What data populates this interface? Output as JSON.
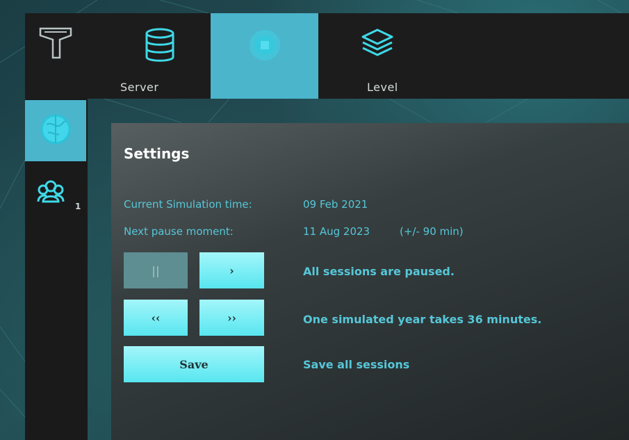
{
  "nav": {
    "tabs": [
      {
        "label": "Server",
        "icon": "database-icon"
      },
      {
        "label": "",
        "icon": "globe-cube-icon",
        "active": true
      },
      {
        "label": "Level",
        "icon": "layers-icon"
      }
    ]
  },
  "sidebar": {
    "items": [
      {
        "icon": "globe-icon",
        "active": true
      },
      {
        "icon": "users-icon",
        "count": "1"
      }
    ]
  },
  "settings": {
    "title": "Settings",
    "current_time_label": "Current Simulation time:",
    "current_time_value": "09 Feb 2021",
    "next_pause_label": "Next pause moment:",
    "next_pause_value": "11 Aug 2023",
    "next_pause_tolerance": "(+/- 90 min)",
    "pause_label": "||",
    "play_label": "›",
    "pause_status": "All sessions are paused.",
    "slower_label": "‹‹",
    "faster_label": "››",
    "speed_status": "One simulated year takes 36 minutes.",
    "save_label": "Save",
    "save_status": "Save all sessions"
  },
  "colors": {
    "accent": "#4bb5cc",
    "button": "#58e6f0",
    "text_cyan": "#56c7d8"
  }
}
